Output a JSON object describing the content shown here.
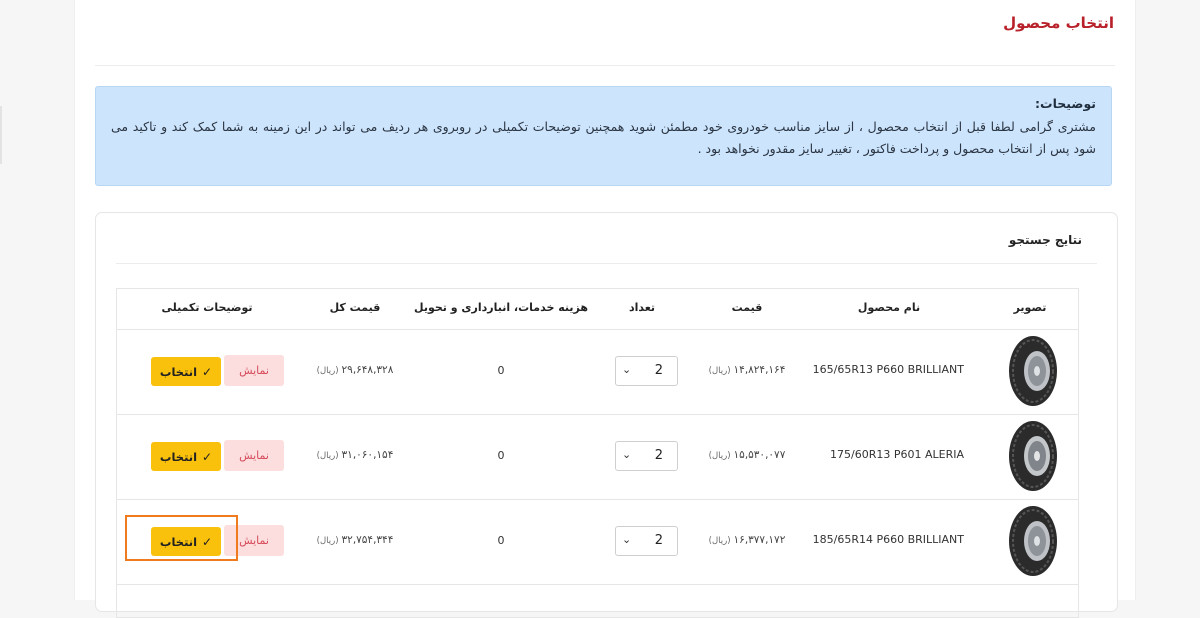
{
  "page": {
    "title": "انتخاب محصول"
  },
  "notice": {
    "title": "توضیحات:",
    "body": "مشتری گرامی لطفا قبل از انتخاب محصول ، از سایز مناسب خودروی خود مطمئن شوید همچنین توضیحات تکمیلی در روبروی هر ردیف می تواند در این زمینه به شما کمک کند و تاکید می شود پس از انتخاب محصول و پرداخت فاکتور ، تغییر سایز مقدور نخواهد بود ."
  },
  "results": {
    "title": "نتایج جستجو",
    "columns": {
      "image": "تصویر",
      "name": "نام محصول",
      "price": "قیمت",
      "qty": "تعداد",
      "service": "هزینه خدمات، انبارداری و تحویل",
      "total": "قیمت کل",
      "more": "توضیحات تکمیلی"
    },
    "currency": "(ریال)",
    "show_label": "نمایش",
    "select_label": "انتخاب",
    "rows": [
      {
        "name": "165/65R13 P660 BRILLIANT",
        "price": "۱۴,۸۲۴,۱۶۴",
        "qty": "2",
        "service": "0",
        "total": "۲۹,۶۴۸,۳۲۸"
      },
      {
        "name": "175/60R13 P601 ALERIA",
        "price": "۱۵,۵۳۰,۰۷۷",
        "qty": "2",
        "service": "0",
        "total": "۳۱,۰۶۰,۱۵۴"
      },
      {
        "name": "185/65R14 P660 BRILLIANT",
        "price": "۱۶,۳۷۷,۱۷۲",
        "qty": "2",
        "service": "0",
        "total": "۳۲,۷۵۴,۳۴۴"
      }
    ]
  },
  "colors": {
    "title_red": "#b8202a",
    "notice_bg": "#cde5fc",
    "select_yellow": "#f9c10b",
    "show_pink": "#fcdede",
    "highlight_orange": "#f07a1e"
  }
}
